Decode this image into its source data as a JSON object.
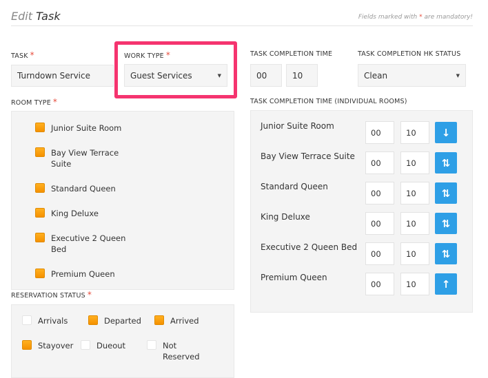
{
  "header": {
    "title_prefix": "Edit",
    "title_main": "Task",
    "mandatory_prefix": "Fields marked with",
    "mandatory_star": "*",
    "mandatory_suffix": "are mandatory!"
  },
  "task": {
    "label": "TASK",
    "value": "Turndown Service"
  },
  "work_type": {
    "label": "WORK TYPE",
    "value": "Guest Services"
  },
  "completion_time": {
    "label": "TASK COMPLETION TIME",
    "hours": "00",
    "minutes": "10"
  },
  "hk_status": {
    "label": "TASK COMPLETION HK STATUS",
    "value": "Clean"
  },
  "room_type": {
    "label": "ROOM TYPE",
    "items": [
      {
        "label": "Junior Suite Room"
      },
      {
        "label": "Bay View Terrace Suite"
      },
      {
        "label": "Standard Queen"
      },
      {
        "label": "King Deluxe"
      },
      {
        "label": "Executive 2 Queen Bed"
      },
      {
        "label": "Premium Queen"
      }
    ]
  },
  "individual": {
    "label": "TASK COMPLETION TIME (INDIVIDUAL ROOMS)",
    "rows": [
      {
        "name": "Junior Suite Room",
        "hours": "00",
        "minutes": "10",
        "icon": "sort-down-icon"
      },
      {
        "name": "Bay View Terrace Suite",
        "hours": "00",
        "minutes": "10",
        "icon": "sort-up-down-icon"
      },
      {
        "name": "Standard Queen",
        "hours": "00",
        "minutes": "10",
        "icon": "sort-up-down-icon"
      },
      {
        "name": "King Deluxe",
        "hours": "00",
        "minutes": "10",
        "icon": "sort-up-down-icon"
      },
      {
        "name": "Executive 2 Queen Bed",
        "hours": "00",
        "minutes": "10",
        "icon": "sort-up-down-icon"
      },
      {
        "name": "Premium Queen",
        "hours": "00",
        "minutes": "10",
        "icon": "sort-up-icon"
      }
    ]
  },
  "reservation_status": {
    "label": "RESERVATION STATUS",
    "items": [
      {
        "label": "Arrivals",
        "checked": false
      },
      {
        "label": "Departed",
        "checked": true
      },
      {
        "label": "Arrived",
        "checked": true
      },
      {
        "label": "Stayover",
        "checked": true
      },
      {
        "label": "Dueout",
        "checked": false
      },
      {
        "label": "Not Reserved",
        "checked": false
      }
    ]
  },
  "colors": {
    "required": "#e74c3c",
    "highlight": "#f5346f",
    "checkbox": "#f59100",
    "sort_button": "#2e9fe6"
  }
}
